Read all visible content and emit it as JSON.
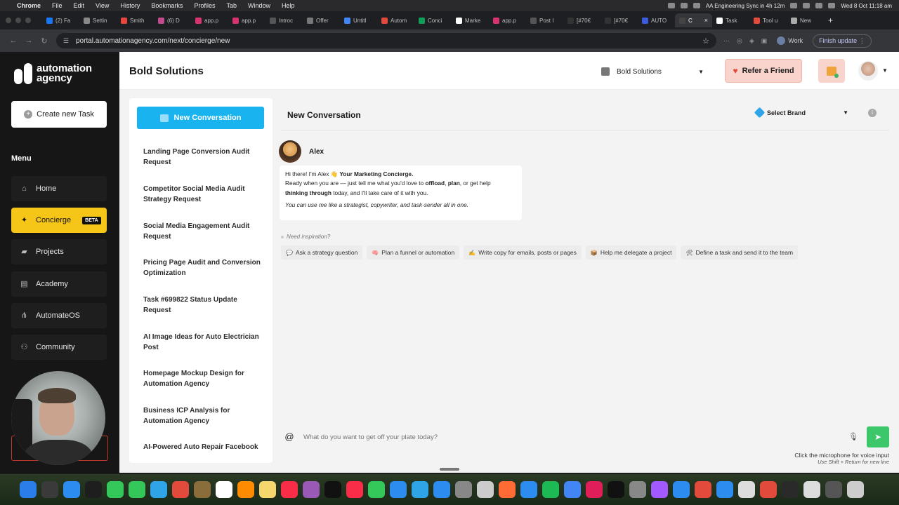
{
  "menubar": {
    "app": "Chrome",
    "items": [
      "File",
      "Edit",
      "View",
      "History",
      "Bookmarks",
      "Profiles",
      "Tab",
      "Window",
      "Help"
    ],
    "event": "AA Engineering Sync in 4h 12m",
    "clock": "Wed 8 Oct  11:18 am"
  },
  "tabs": [
    {
      "label": "(2) Fa",
      "color": "#1877f2"
    },
    {
      "label": "Settin",
      "color": "#888888"
    },
    {
      "label": "Smith",
      "color": "#e8453c"
    },
    {
      "label": "(6) D",
      "color": "#c04a8c"
    },
    {
      "label": "app.p",
      "color": "#d6336c"
    },
    {
      "label": "app.p",
      "color": "#d6336c"
    },
    {
      "label": "Introc",
      "color": "#555555"
    },
    {
      "label": "Offer",
      "color": "#777777"
    },
    {
      "label": "Untitl",
      "color": "#4285f4"
    },
    {
      "label": "Autom",
      "color": "#e24a3b"
    },
    {
      "label": "Conci",
      "color": "#0f9d58"
    },
    {
      "label": "Marke",
      "color": "#ffffff"
    },
    {
      "label": "app.p",
      "color": "#d6336c"
    },
    {
      "label": "Post I",
      "color": "#555555"
    },
    {
      "label": "[#70€",
      "color": "#333333"
    },
    {
      "label": "[#70€",
      "color": "#333333"
    },
    {
      "label": "AUTO",
      "color": "#3b5bdb"
    },
    {
      "label": "C",
      "color": "#444444",
      "active": true
    },
    {
      "label": "Task",
      "color": "#ffffff"
    },
    {
      "label": "Tool u",
      "color": "#e24a3b"
    },
    {
      "label": "New",
      "color": "#aaaaaa"
    }
  ],
  "address": {
    "url": "portal.automationagency.com/next/concierge/new",
    "profile": "Work",
    "finish_update": "Finish update"
  },
  "sidebar": {
    "logo_line1": "automation",
    "logo_line2": "agency",
    "create_task": "Create new Task",
    "menu_label": "Menu",
    "items": [
      {
        "label": "Home",
        "icon": "home-icon"
      },
      {
        "label": "Concierge",
        "icon": "sparkle-icon",
        "badge": "BETA",
        "active": true
      },
      {
        "label": "Projects",
        "icon": "folder-icon"
      },
      {
        "label": "Academy",
        "icon": "book-icon"
      },
      {
        "label": "AutomateOS",
        "icon": "network-icon"
      },
      {
        "label": "Community",
        "icon": "people-icon"
      }
    ]
  },
  "header": {
    "title": "Bold Solutions",
    "brand_select": "Bold Solutions",
    "refer": "Refer a Friend"
  },
  "conversations": {
    "new_button": "New Conversation",
    "items": [
      "Landing Page Conversion Audit Request",
      "Competitor Social Media Audit Strategy Request",
      "Social Media Engagement Audit Request",
      "Pricing Page Audit and Conversion Optimization",
      "Task #699822 Status Update Request",
      "AI Image Ideas for Auto Electrician Post",
      "Homepage Mockup Design for Automation Agency",
      "Business ICP Analysis for Automation Agency",
      "AI-Powered Auto Repair Facebook"
    ]
  },
  "chat": {
    "title": "New Conversation",
    "select_brand": "Select Brand",
    "agent_name": "Alex",
    "message": {
      "greeting": "Hi there! I'm Alex 👋 ",
      "role": "Your Marketing Concierge.",
      "line2_a": "Ready when you are — just tell me what you'd love to ",
      "offload": "offload",
      "comma": ", ",
      "plan": "plan",
      "line2_b": ", or get help",
      "thinking": "thinking through",
      "line3": " today, and I'll take care of it with you.",
      "italic": "You can use me like a strategist, copywriter, and task-sender all in one."
    },
    "inspiration_label": "Need inspiration?",
    "suggestions": [
      {
        "label": "Ask a strategy question",
        "icon": "💬"
      },
      {
        "label": "Plan a funnel or automation",
        "icon": "🧠"
      },
      {
        "label": "Write copy for emails, posts or pages",
        "icon": "✍"
      },
      {
        "label": "Help me delegate a project",
        "icon": "📦"
      },
      {
        "label": "Define a task and send it to the team",
        "icon": "🛠"
      }
    ],
    "input_placeholder": "What do you want to get off your plate today?",
    "hint_main": "Click the microphone for voice input",
    "hint_sub": "Use Shift + Return for new line"
  },
  "dock_colors": [
    "#2b7de9",
    "#3a3a3a",
    "#2d8cf0",
    "#1e1e1e",
    "#34c759",
    "#34c759",
    "#2fa4e7",
    "#e24a3b",
    "#8a6d3b",
    "#ffffff",
    "#ff8c00",
    "#f5d76e",
    "#fa2d48",
    "#9b59b6",
    "#111111",
    "#fa2d48",
    "#34c759",
    "#2d8cf0",
    "#2fa4e7",
    "#2d8cf0",
    "#888888",
    "#cccccc",
    "#ff6b35",
    "#2d8cf0",
    "#1db954",
    "#4285f4",
    "#e01e5a",
    "#111111",
    "#888888",
    "#a259ff",
    "#2d8cf0",
    "#e24a3b",
    "#2d8cf0",
    "#dddddd",
    "#e24a3b",
    "#2a2a2a",
    "#dddddd",
    "#555555",
    "#cccccc"
  ]
}
